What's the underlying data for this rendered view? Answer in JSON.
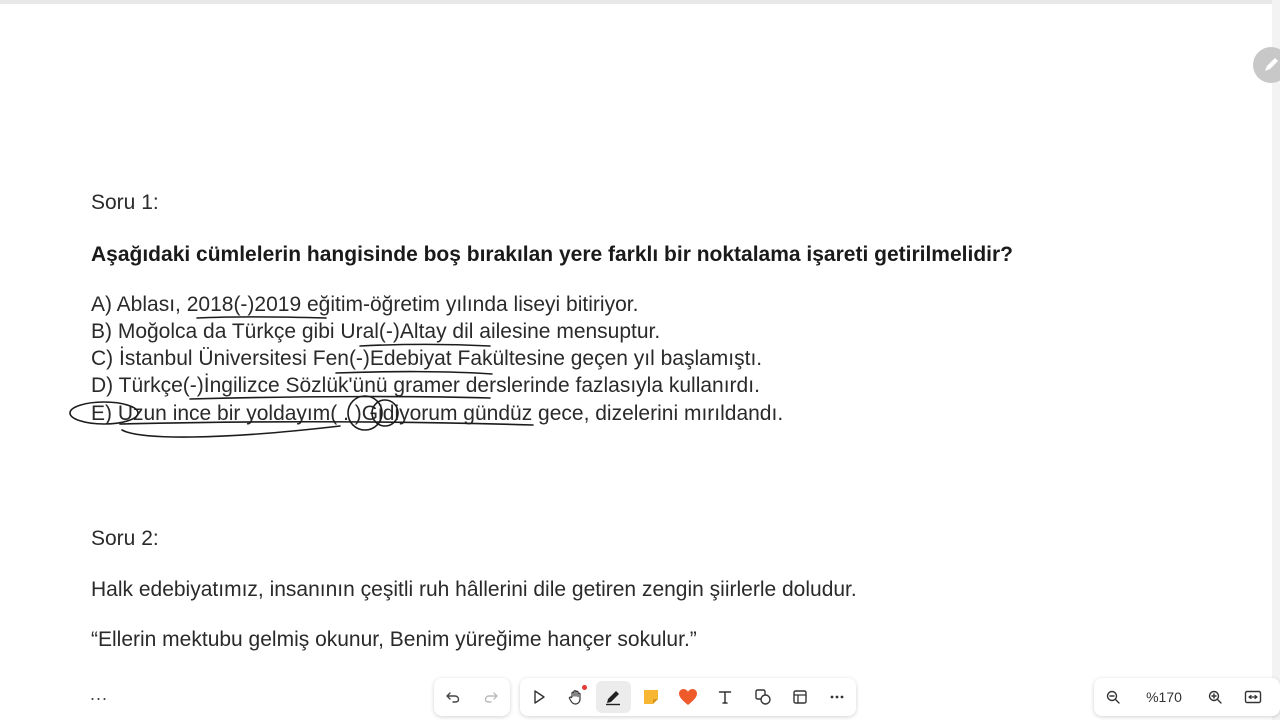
{
  "document": {
    "soru1_title": "Soru 1:",
    "soru1_question": "Aşağıdaki cümlelerin hangisinde boş bırakılan yere farklı bir noktalama işareti getirilmelidir?",
    "options": [
      {
        "prefix": "A) Ablası, ",
        "blank_left": "2018",
        "blank": "(-)",
        "blank_right": "2019",
        "suffix": " eğitim-öğretim yılında liseyi bitiriyor."
      },
      {
        "prefix": "B) Moğolca da Türkçe gibi ",
        "blank_left": "Ural",
        "blank": "(-)",
        "blank_right": "Altay",
        "suffix": " dil ailesine mensuptur."
      },
      {
        "prefix": "C) İstanbul Üniversitesi ",
        "blank_left": "Fen",
        "blank": "(-)",
        "blank_right": "Edebiyat",
        "suffix": " Fakültesine geçen yıl başlamıştı."
      },
      {
        "prefix": "D) Türkçe",
        "blank_left": "",
        "blank": "(-)",
        "blank_right": "İngilizce",
        "suffix": " Sözlük'ünü gramer derslerinde fazlasıyla kullanırdı."
      },
      {
        "prefix": "E) Uzun ince bir yoldayım",
        "blank_left": "",
        "blank": "( . )",
        "blank_right": "Gidiyorum",
        "suffix": " gündüz gece, dizelerini mırıldandı."
      }
    ],
    "soru2_title": "Soru 2:",
    "soru2_text": "Halk edebiyatımız, insanının çeşitli ruh hâllerini dile getiren zengin şiirlerle doludur.",
    "soru2_quote": "“Ellerin mektubu gelmiş okunur, Benim yüreğime hançer sokulur.”"
  },
  "toolbar": {
    "more_left": "...",
    "zoom_label": "%170",
    "icons": {
      "undo": "undo-icon",
      "redo": "redo-icon",
      "select": "pointer-icon",
      "hand": "hand-icon",
      "pen": "pen-icon",
      "sticky": "sticky-note-icon",
      "heart": "heart-icon",
      "text": "text-icon",
      "shapes": "shapes-icon",
      "frame": "frame-icon",
      "more": "more-icon",
      "zoom_out": "zoom-out-icon",
      "zoom_in": "zoom-in-icon",
      "fit": "fit-screen-icon"
    }
  },
  "colors": {
    "ink": "#1c1c1c",
    "sticky": "#f7b733",
    "heart": "#ef5a2b",
    "record_dot": "#e53935"
  }
}
